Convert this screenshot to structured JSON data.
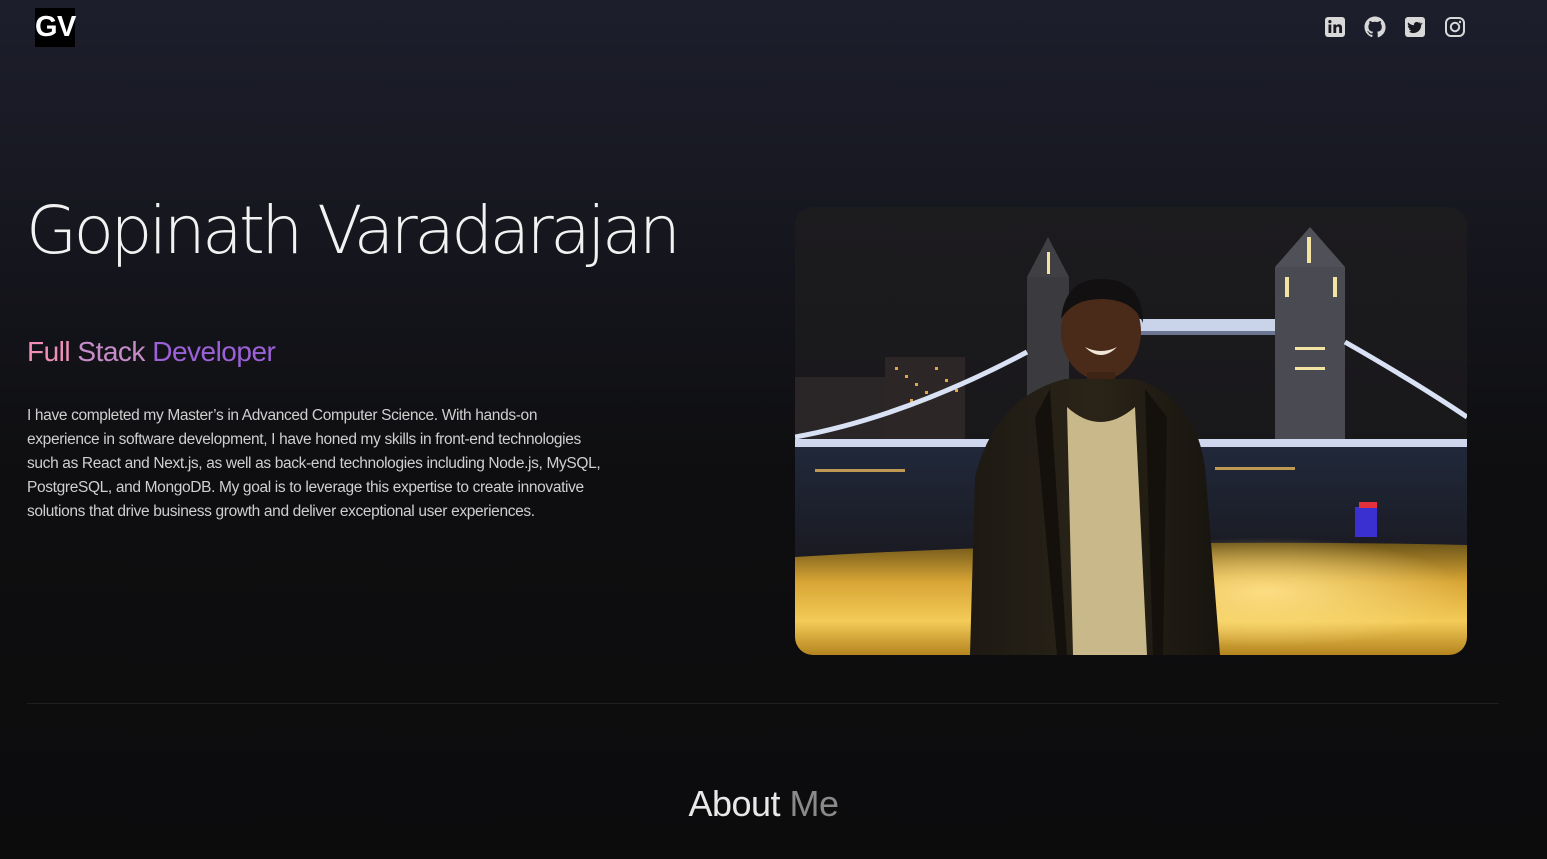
{
  "header": {
    "logo_text": "GV",
    "socials": [
      {
        "icon": "linkedin-icon"
      },
      {
        "icon": "github-icon"
      },
      {
        "icon": "twitter-icon"
      },
      {
        "icon": "instagram-icon"
      }
    ]
  },
  "hero": {
    "name": "Gopinath Varadarajan",
    "role_words": [
      "Full",
      "Stack",
      "Developer"
    ],
    "role_colors": [
      "#ef8fb7",
      "#c68cc8",
      "#9a62d6"
    ],
    "bio": "I have completed my Master’s in Advanced Computer Science. With hands-on experience in software development, I have honed my skills in front-end technologies such as React and Next.js, as well as back-end technologies including Node.js, MySQL, PostgreSQL, and MongoDB. My goal is to leverage this expertise to create innovative solutions that drive business growth and deliver exceptional user experiences."
  },
  "about": {
    "title_part1": "About",
    "title_part2": "Me"
  },
  "colors": {
    "background_top": "#1d1e2c",
    "background_bottom": "#0c0c0d",
    "text": "#f2f2f2"
  }
}
